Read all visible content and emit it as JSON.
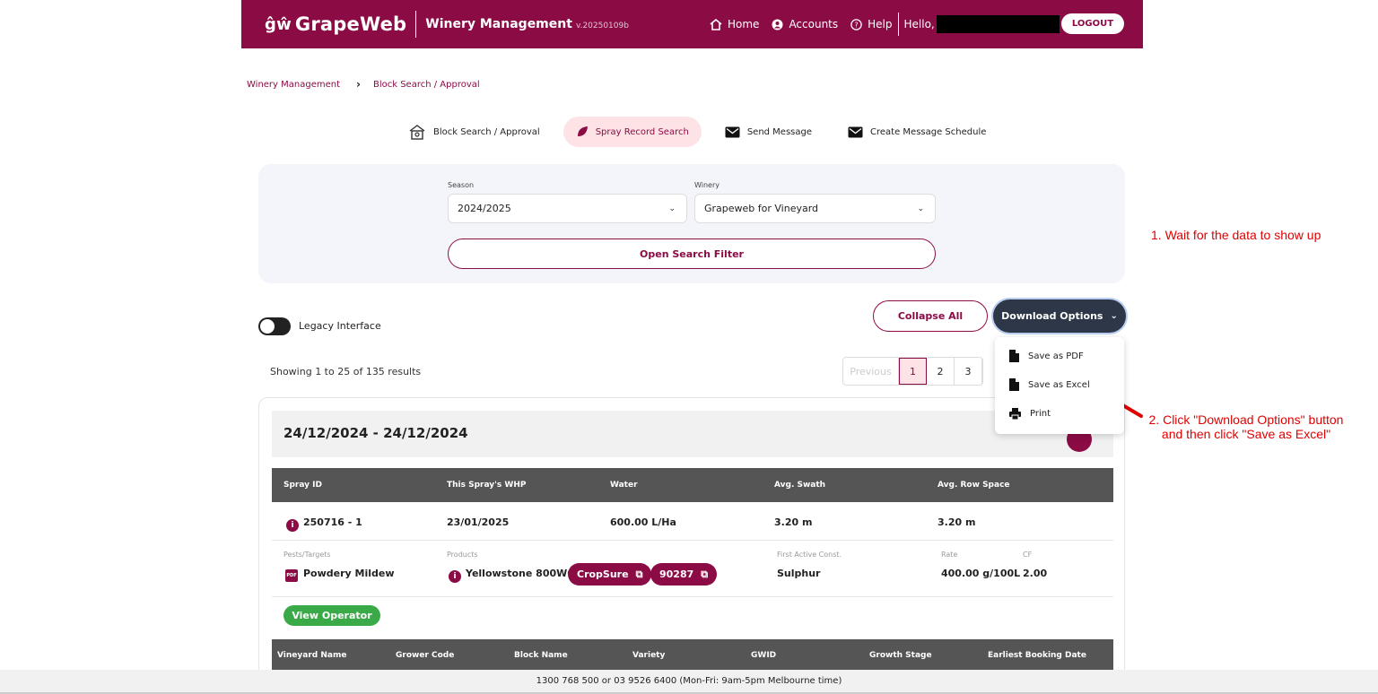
{
  "header": {
    "logo_mark": "ĝŵ",
    "logo_text": "GrapeWeb",
    "app_title": "Winery Management",
    "version": "v.20250109b",
    "nav": {
      "home": "Home",
      "accounts": "Accounts",
      "help": "Help"
    },
    "hello": "Hello,",
    "logout": "LOGOUT",
    "brand_color": "#8b0b45"
  },
  "breadcrumb": {
    "root": "Winery Management",
    "current": "Block Search / Approval"
  },
  "tabs": [
    {
      "label": "Block Search / Approval",
      "icon": "house-icon"
    },
    {
      "label": "Spray Record Search",
      "icon": "leaf-icon"
    },
    {
      "label": "Send Message",
      "icon": "envelope-icon"
    },
    {
      "label": "Create Message Schedule",
      "icon": "envelope-icon"
    }
  ],
  "filter": {
    "season_label": "Season",
    "season_value": "2024/2025",
    "winery_label": "Winery",
    "winery_value": "Grapeweb for Vineyard",
    "open_filter": "Open Search Filter"
  },
  "toolbar": {
    "legacy_label": "Legacy Interface",
    "collapse_all": "Collapse All",
    "download_options": "Download Options",
    "menu": {
      "pdf": "Save as PDF",
      "excel": "Save as Excel",
      "print": "Print"
    }
  },
  "results": {
    "showing": "Showing 1 to 25 of 135 results"
  },
  "pager": {
    "prev": "Previous",
    "pages": [
      "1",
      "2",
      "3"
    ]
  },
  "card": {
    "title": "24/12/2024 - 24/12/2024",
    "headers": [
      "Spray ID",
      "This Spray's WHP",
      "Water",
      "Avg. Swath",
      "Avg. Row Space"
    ],
    "row": {
      "spray_id": "250716 - 1",
      "whp": "23/01/2025",
      "water": "600.00 L/Ha",
      "swath": "3.20 m",
      "row_space": "3.20 m"
    },
    "sub_labels": {
      "pests": "Pests/Targets",
      "products": "Products",
      "first_active": "First Active Const.",
      "rate": "Rate",
      "cf": "CF"
    },
    "sub_values": {
      "pest": "Powdery Mildew",
      "product": "Yellowstone 800WG",
      "cropsure": "CropSure",
      "code": "90287",
      "active": "Sulphur",
      "rate": "400.00 g/100L",
      "cf": "2.00"
    },
    "view_operator": "View Operator",
    "headers2": [
      "Vineyard Name",
      "Grower Code",
      "Block Name",
      "Variety",
      "GWID",
      "Growth Stage",
      "Earliest Booking Date"
    ]
  },
  "footer": {
    "text": "1300 768 500 or 03 9526 6400 (Mon-Fri: 9am-5pm Melbourne time)"
  },
  "annotations": {
    "step1": "1. Wait for the data to show up",
    "step2": "2. Click \"Download Options\" button and then click \"Save as Excel\""
  }
}
